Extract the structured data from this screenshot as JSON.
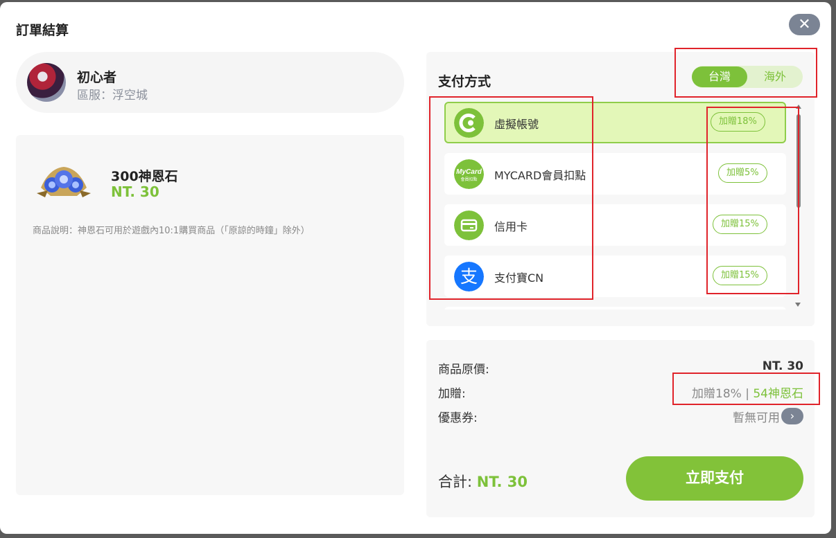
{
  "dialog": {
    "title": "訂單結算",
    "close_glyph": "✕"
  },
  "user": {
    "name": "初心者",
    "server": "區服：浮空城"
  },
  "product": {
    "name": "300神恩石",
    "price": "NT. 30",
    "description": "商品說明：神恩石可用於遊戲內10:1購買商品（「原諒的時鐘」除外）"
  },
  "payment": {
    "title": "支付方式",
    "regions": [
      "台灣",
      "海外"
    ],
    "selected_region": "台灣",
    "methods": [
      {
        "label": "虛擬帳號",
        "bonus": "加贈18%",
        "icon": "virtual-account-icon",
        "selected": true
      },
      {
        "label": "MYCARD會員扣點",
        "bonus": "加贈5%",
        "icon": "mycard-icon",
        "logo_text": "MyCard",
        "logo_subtext": "會員扣點"
      },
      {
        "label": "信用卡",
        "bonus": "加贈15%",
        "icon": "credit-card-icon"
      },
      {
        "label": "支付寶CN",
        "bonus": "加贈15%",
        "icon": "alipay-icon",
        "logo_text": "支"
      }
    ]
  },
  "summary": {
    "original_label": "商品原價:",
    "original_value": "NT. 30",
    "bonus_label": "加贈:",
    "bonus_percent": "加贈18%",
    "bonus_sep": "|",
    "bonus_amount": "54神恩石",
    "coupon_label": "優惠券:",
    "coupon_value": "暫無可用",
    "coupon_arrow": "›",
    "total_label": "合計:",
    "total_value": "NT. 30",
    "pay_button": "立即支付"
  },
  "colors": {
    "accent": "#7dc13a",
    "highlight": "#e0232a",
    "selected_bg": "#e3f7b8"
  }
}
